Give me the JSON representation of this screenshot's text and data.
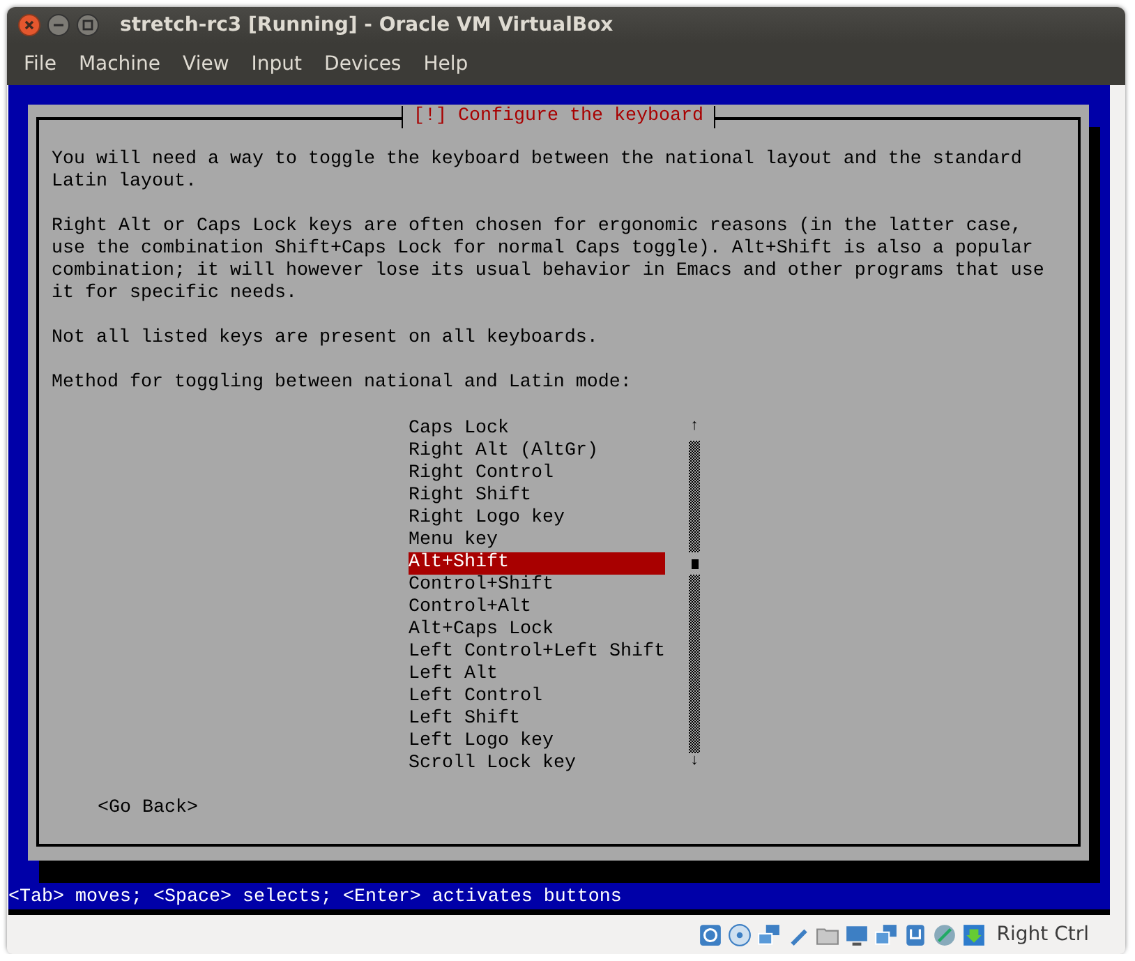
{
  "window": {
    "title": "stretch-rc3 [Running] - Oracle VM VirtualBox"
  },
  "menu": [
    "File",
    "Machine",
    "View",
    "Input",
    "Devices",
    "Help"
  ],
  "dialog": {
    "title": "[!] Configure the keyboard",
    "paragraphs": [
      "You will need a way to toggle the keyboard between the national layout and the standard Latin layout.",
      "Right Alt or Caps Lock keys are often chosen for ergonomic reasons (in the latter case, use the combination Shift+Caps Lock for normal Caps toggle). Alt+Shift is also a popular combination; it will however lose its usual behavior in Emacs and other programs that use it for specific needs.",
      "Not all listed keys are present on all keyboards.",
      "Method for toggling between national and Latin mode:"
    ],
    "scroll_up": "↑",
    "scroll_down": "↓",
    "options": [
      {
        "label": "Caps Lock",
        "selected": false
      },
      {
        "label": "Right Alt (AltGr)",
        "selected": false
      },
      {
        "label": "Right Control",
        "selected": false
      },
      {
        "label": "Right Shift",
        "selected": false
      },
      {
        "label": "Right Logo key",
        "selected": false
      },
      {
        "label": "Menu key",
        "selected": false
      },
      {
        "label": "Alt+Shift",
        "selected": true
      },
      {
        "label": "Control+Shift",
        "selected": false
      },
      {
        "label": "Control+Alt",
        "selected": false
      },
      {
        "label": "Alt+Caps Lock",
        "selected": false
      },
      {
        "label": "Left Control+Left Shift",
        "selected": false
      },
      {
        "label": "Left Alt",
        "selected": false
      },
      {
        "label": "Left Control",
        "selected": false
      },
      {
        "label": "Left Shift",
        "selected": false
      },
      {
        "label": "Left Logo key",
        "selected": false
      },
      {
        "label": "Scroll Lock key",
        "selected": false
      }
    ],
    "back_button": "<Go Back>"
  },
  "help_line": "<Tab> moves; <Space> selects; <Enter> activates buttons",
  "status_bar": {
    "host_key": "Right Ctrl"
  }
}
